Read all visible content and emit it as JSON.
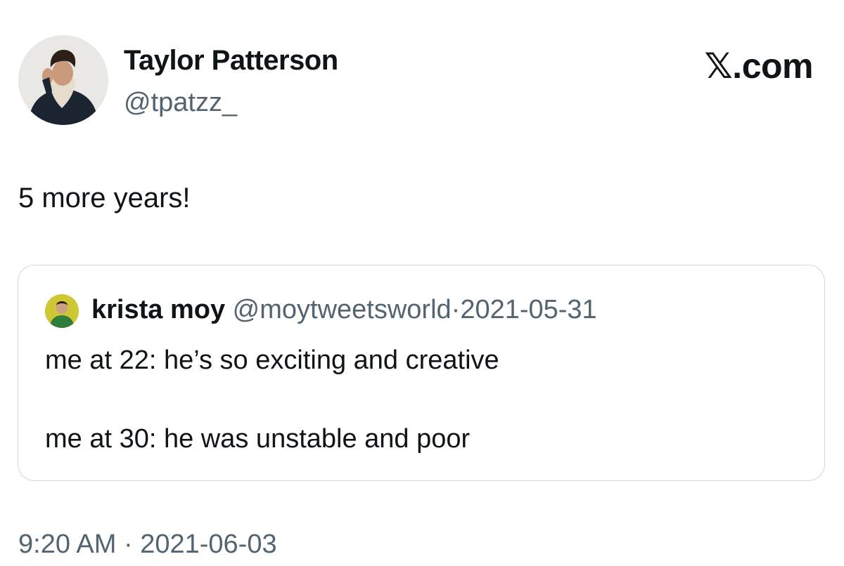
{
  "author": {
    "display_name": "Taylor Patterson",
    "handle": "@tpatzz_",
    "avatar_icon": "profile-photo-avatar"
  },
  "brand": {
    "label": "𝕏.com"
  },
  "tweet": {
    "text": "5 more years!",
    "time": "9:20 AM",
    "separator": "·",
    "date": "2021-06-03"
  },
  "quote": {
    "avatar_icon": "profile-photo-avatar",
    "display_name": "krista moy",
    "handle": "@moytweetsworld",
    "separator": "·",
    "date": "2021-05-31",
    "line_1": "me at 22: he’s so exciting and creative",
    "line_2": "me at 30: he was unstable and poor"
  },
  "colors": {
    "text_primary": "#0f1419",
    "text_secondary": "#536471",
    "card_border": "#cfd9de",
    "background": "#ffffff"
  }
}
